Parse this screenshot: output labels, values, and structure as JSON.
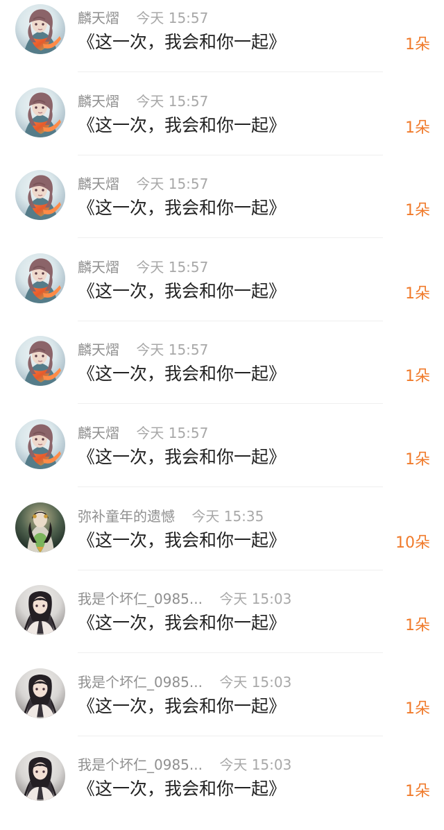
{
  "colors": {
    "background": "#ffffff",
    "name": "#8f8f8f",
    "time": "#a8a8a8",
    "message": "#222222",
    "count": "#f07a2a",
    "divider": "#efefef"
  },
  "rows": [
    {
      "avatar_icon": "avatar-anime-girl-scarf-icon",
      "name": "麟天熠",
      "time": "今天 15:57",
      "message": "《这一次，我会和你一起》",
      "count": "1朵"
    },
    {
      "avatar_icon": "avatar-anime-girl-scarf-icon",
      "name": "麟天熠",
      "time": "今天 15:57",
      "message": "《这一次，我会和你一起》",
      "count": "1朵"
    },
    {
      "avatar_icon": "avatar-anime-girl-scarf-icon",
      "name": "麟天熠",
      "time": "今天 15:57",
      "message": "《这一次，我会和你一起》",
      "count": "1朵"
    },
    {
      "avatar_icon": "avatar-anime-girl-scarf-icon",
      "name": "麟天熠",
      "time": "今天 15:57",
      "message": "《这一次，我会和你一起》",
      "count": "1朵"
    },
    {
      "avatar_icon": "avatar-anime-girl-scarf-icon",
      "name": "麟天熠",
      "time": "今天 15:57",
      "message": "《这一次，我会和你一起》",
      "count": "1朵"
    },
    {
      "avatar_icon": "avatar-anime-girl-scarf-icon",
      "name": "麟天熠",
      "time": "今天 15:57",
      "message": "《这一次，我会和你一起》",
      "count": "1朵"
    },
    {
      "avatar_icon": "avatar-green-dress-girl-icon",
      "name": "弥补童年的遗憾",
      "time": "今天 15:35",
      "message": "《这一次，我会和你一起》",
      "count": "10朵"
    },
    {
      "avatar_icon": "avatar-dark-hair-girl-icon",
      "name": "我是个坏仁_0985...",
      "time": "今天 15:03",
      "message": "《这一次，我会和你一起》",
      "count": "1朵"
    },
    {
      "avatar_icon": "avatar-dark-hair-girl-icon",
      "name": "我是个坏仁_0985...",
      "time": "今天 15:03",
      "message": "《这一次，我会和你一起》",
      "count": "1朵"
    },
    {
      "avatar_icon": "avatar-dark-hair-girl-icon",
      "name": "我是个坏仁_0985...",
      "time": "今天 15:03",
      "message": "《这一次，我会和你一起》",
      "count": "1朵"
    }
  ]
}
